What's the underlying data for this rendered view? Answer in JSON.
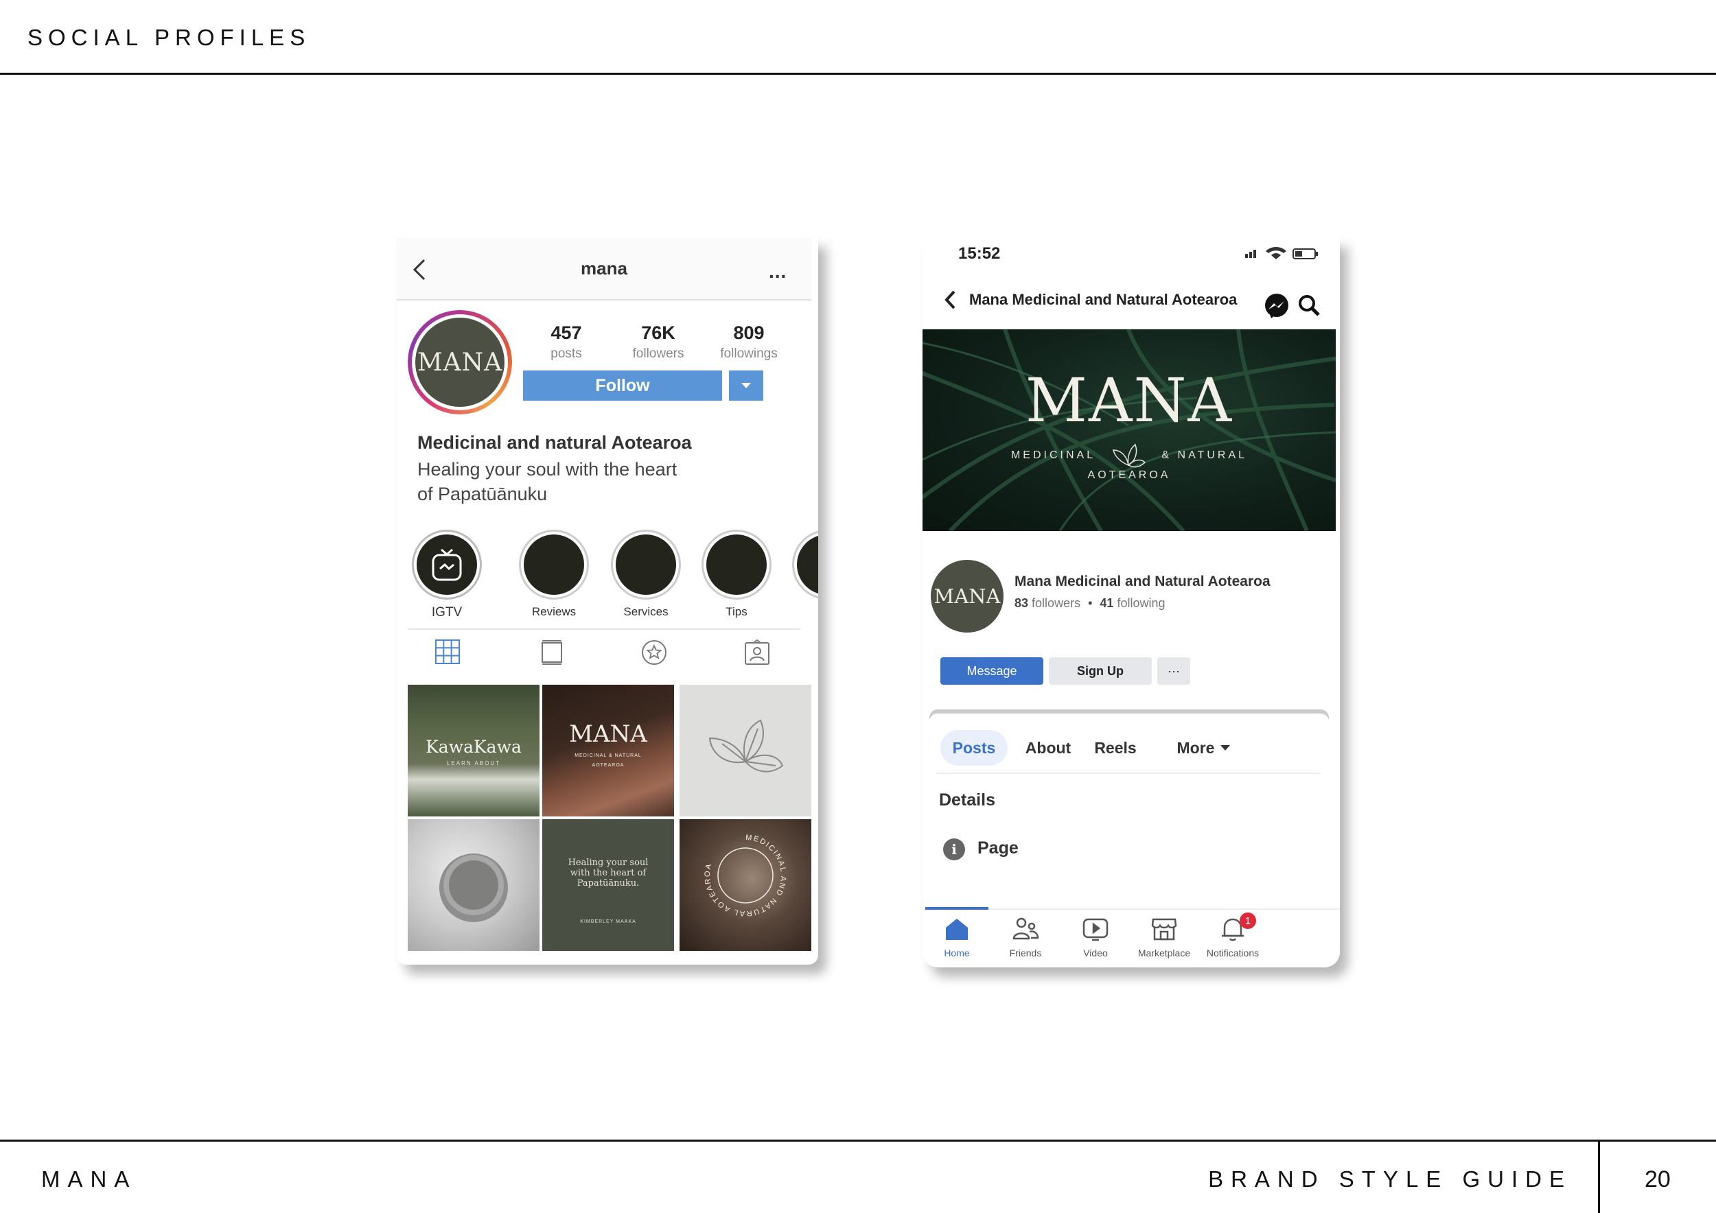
{
  "page": {
    "section_title": "SOCIAL PROFILES",
    "brand": "MANA",
    "guide": "BRAND STYLE GUIDE",
    "page_number": "20"
  },
  "instagram": {
    "username": "mana",
    "more": "...",
    "avatar_text": "MANA",
    "stats": [
      {
        "value": "457",
        "label": "posts"
      },
      {
        "value": "76K",
        "label": "followers"
      },
      {
        "value": "809",
        "label": "followings"
      }
    ],
    "follow_label": "Follow",
    "bio_name": "Medicinal and natural Aotearoa",
    "bio_line1": "Healing your soul with the heart",
    "bio_line2": "of Papatūānuku",
    "highlights": [
      "IGTV",
      "Reviews",
      "Services",
      "Tips"
    ],
    "tiles": {
      "kawakawa": "KawaKawa",
      "kawakawa_sub": "LEARN ABOUT",
      "mana": "MANA",
      "mana_sub": "MEDICINAL & NATURAL",
      "mana_sub2": "AOTEAROA",
      "quote": "Healing your soul with the heart of Papatūānuku.",
      "author": "KIMBERLEY MAAKA",
      "ring_text": "MEDICINAL AND NATURAL AOTEAROA"
    }
  },
  "facebook": {
    "time": "15:52",
    "header_title": "Mana Medicinal and Natural Aotearoa",
    "cover_logo": "MANA",
    "cover_sub_left": "MEDICINAL",
    "cover_sub_right": "& NATURAL",
    "cover_sub2": "AOTEAROA",
    "avatar_text": "MANA",
    "page_name": "Mana Medicinal and Natural Aotearoa",
    "followers_count": "83",
    "followers_label": "followers",
    "following_count": "41",
    "following_label": "following",
    "meta_separator": "•",
    "message_label": "Message",
    "signup_label": "Sign Up",
    "more_btn": "···",
    "tabs": [
      "Posts",
      "About",
      "Reels",
      "More"
    ],
    "details_heading": "Details",
    "page_label": "Page",
    "nav": [
      "Home",
      "Friends",
      "Video",
      "Marketplace",
      "Notifications"
    ],
    "notification_count": "1",
    "colors": {
      "primary": "#3b72c8",
      "badge": "#e0283b"
    }
  }
}
